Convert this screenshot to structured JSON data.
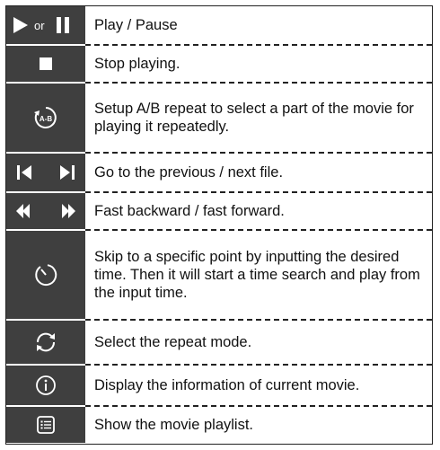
{
  "rows": [
    {
      "icon_name": "play-pause-icon",
      "or_text": "or",
      "text": "Play / Pause"
    },
    {
      "icon_name": "stop-icon",
      "text": "Stop playing."
    },
    {
      "icon_name": "ab-repeat-icon",
      "ab_label": "A-B",
      "text": "Setup A/B repeat to select a part of the movie for playing it repeatedly."
    },
    {
      "icon_name": "prev-next-icon",
      "text": "Go to the previous / next file."
    },
    {
      "icon_name": "rewind-forward-icon",
      "text": "Fast backward / fast forward."
    },
    {
      "icon_name": "time-search-icon",
      "text": "Skip to a specific point by inputting the desired time. Then it will start a time search and play from the input time."
    },
    {
      "icon_name": "repeat-icon",
      "text": "Select the repeat mode."
    },
    {
      "icon_name": "info-icon",
      "text": "Display the information of current movie."
    },
    {
      "icon_name": "playlist-icon",
      "text": "Show the movie playlist."
    }
  ]
}
